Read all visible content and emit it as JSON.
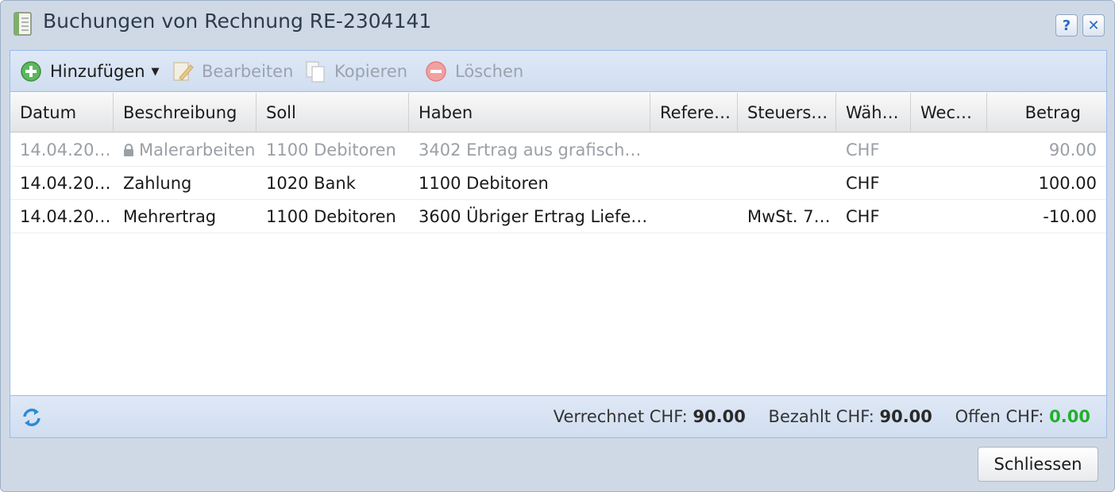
{
  "window": {
    "title": "Buchungen von Rechnung RE-2304141",
    "help_label": "?",
    "close_label": "✕"
  },
  "toolbar": {
    "add": "Hinzufügen",
    "edit": "Bearbeiten",
    "copy": "Kopieren",
    "delete": "Löschen"
  },
  "grid": {
    "columns": [
      "Datum",
      "Beschreibung",
      "Soll",
      "Haben",
      "Refere…",
      "Steuers…",
      "Wäh…",
      "Wec…",
      "Betrag"
    ],
    "rows": [
      {
        "date": "14.04.20…",
        "description": "Malerarbeiten",
        "debit": "1100 Debitoren",
        "credit": "3402 Ertrag aus grafischen…",
        "reference": "",
        "tax": "",
        "currency": "CHF",
        "exchange": "",
        "amount": "90.00",
        "locked": true
      },
      {
        "date": "14.04.20…",
        "description": "Zahlung",
        "debit": "1020 Bank",
        "credit": "1100 Debitoren",
        "reference": "",
        "tax": "",
        "currency": "CHF",
        "exchange": "",
        "amount": "100.00",
        "locked": false
      },
      {
        "date": "14.04.20…",
        "description": "Mehrertrag",
        "debit": "1100 Debitoren",
        "credit": "3600 Übriger Ertrag Liefer…",
        "reference": "",
        "tax": "MwSt. 7…",
        "currency": "CHF",
        "exchange": "",
        "amount": "-10.00",
        "locked": false
      }
    ]
  },
  "summary": {
    "charged_label": "Verrechnet CHF:",
    "charged_value": "90.00",
    "paid_label": "Bezahlt CHF:",
    "paid_value": "90.00",
    "open_label": "Offen CHF:",
    "open_value": "0.00"
  },
  "buttons": {
    "close": "Schliessen"
  },
  "colors": {
    "open_value": "#22b02b",
    "panel_border": "#99bbe8",
    "disabled_text": "#9aa3ad"
  }
}
